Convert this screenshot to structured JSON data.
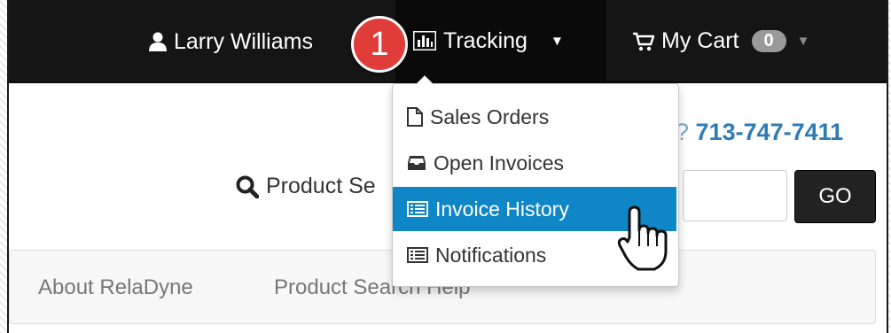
{
  "navbar": {
    "user_name": "Larry Williams",
    "tracking_label": "Tracking",
    "cart_label": "My Cart",
    "cart_count": "0"
  },
  "step_number": "1",
  "tracking_menu": {
    "items": [
      {
        "label": "Sales Orders",
        "icon": "document-icon"
      },
      {
        "label": "Open Invoices",
        "icon": "inbox-icon"
      },
      {
        "label": "Invoice History",
        "icon": "list-icon",
        "active": true
      },
      {
        "label": "Notifications",
        "icon": "list-icon"
      }
    ]
  },
  "contact": {
    "phone_prefix": "?",
    "phone": "713-747-7411"
  },
  "search": {
    "label": "Product Se",
    "go_label": "GO"
  },
  "subnav": {
    "items": [
      "About RelaDyne",
      "Product Search Help"
    ]
  },
  "colors": {
    "navbar": "#151515",
    "active_item": "#0f86c6",
    "step_badge": "#e03c3a",
    "phone": "#2f7bb5"
  }
}
